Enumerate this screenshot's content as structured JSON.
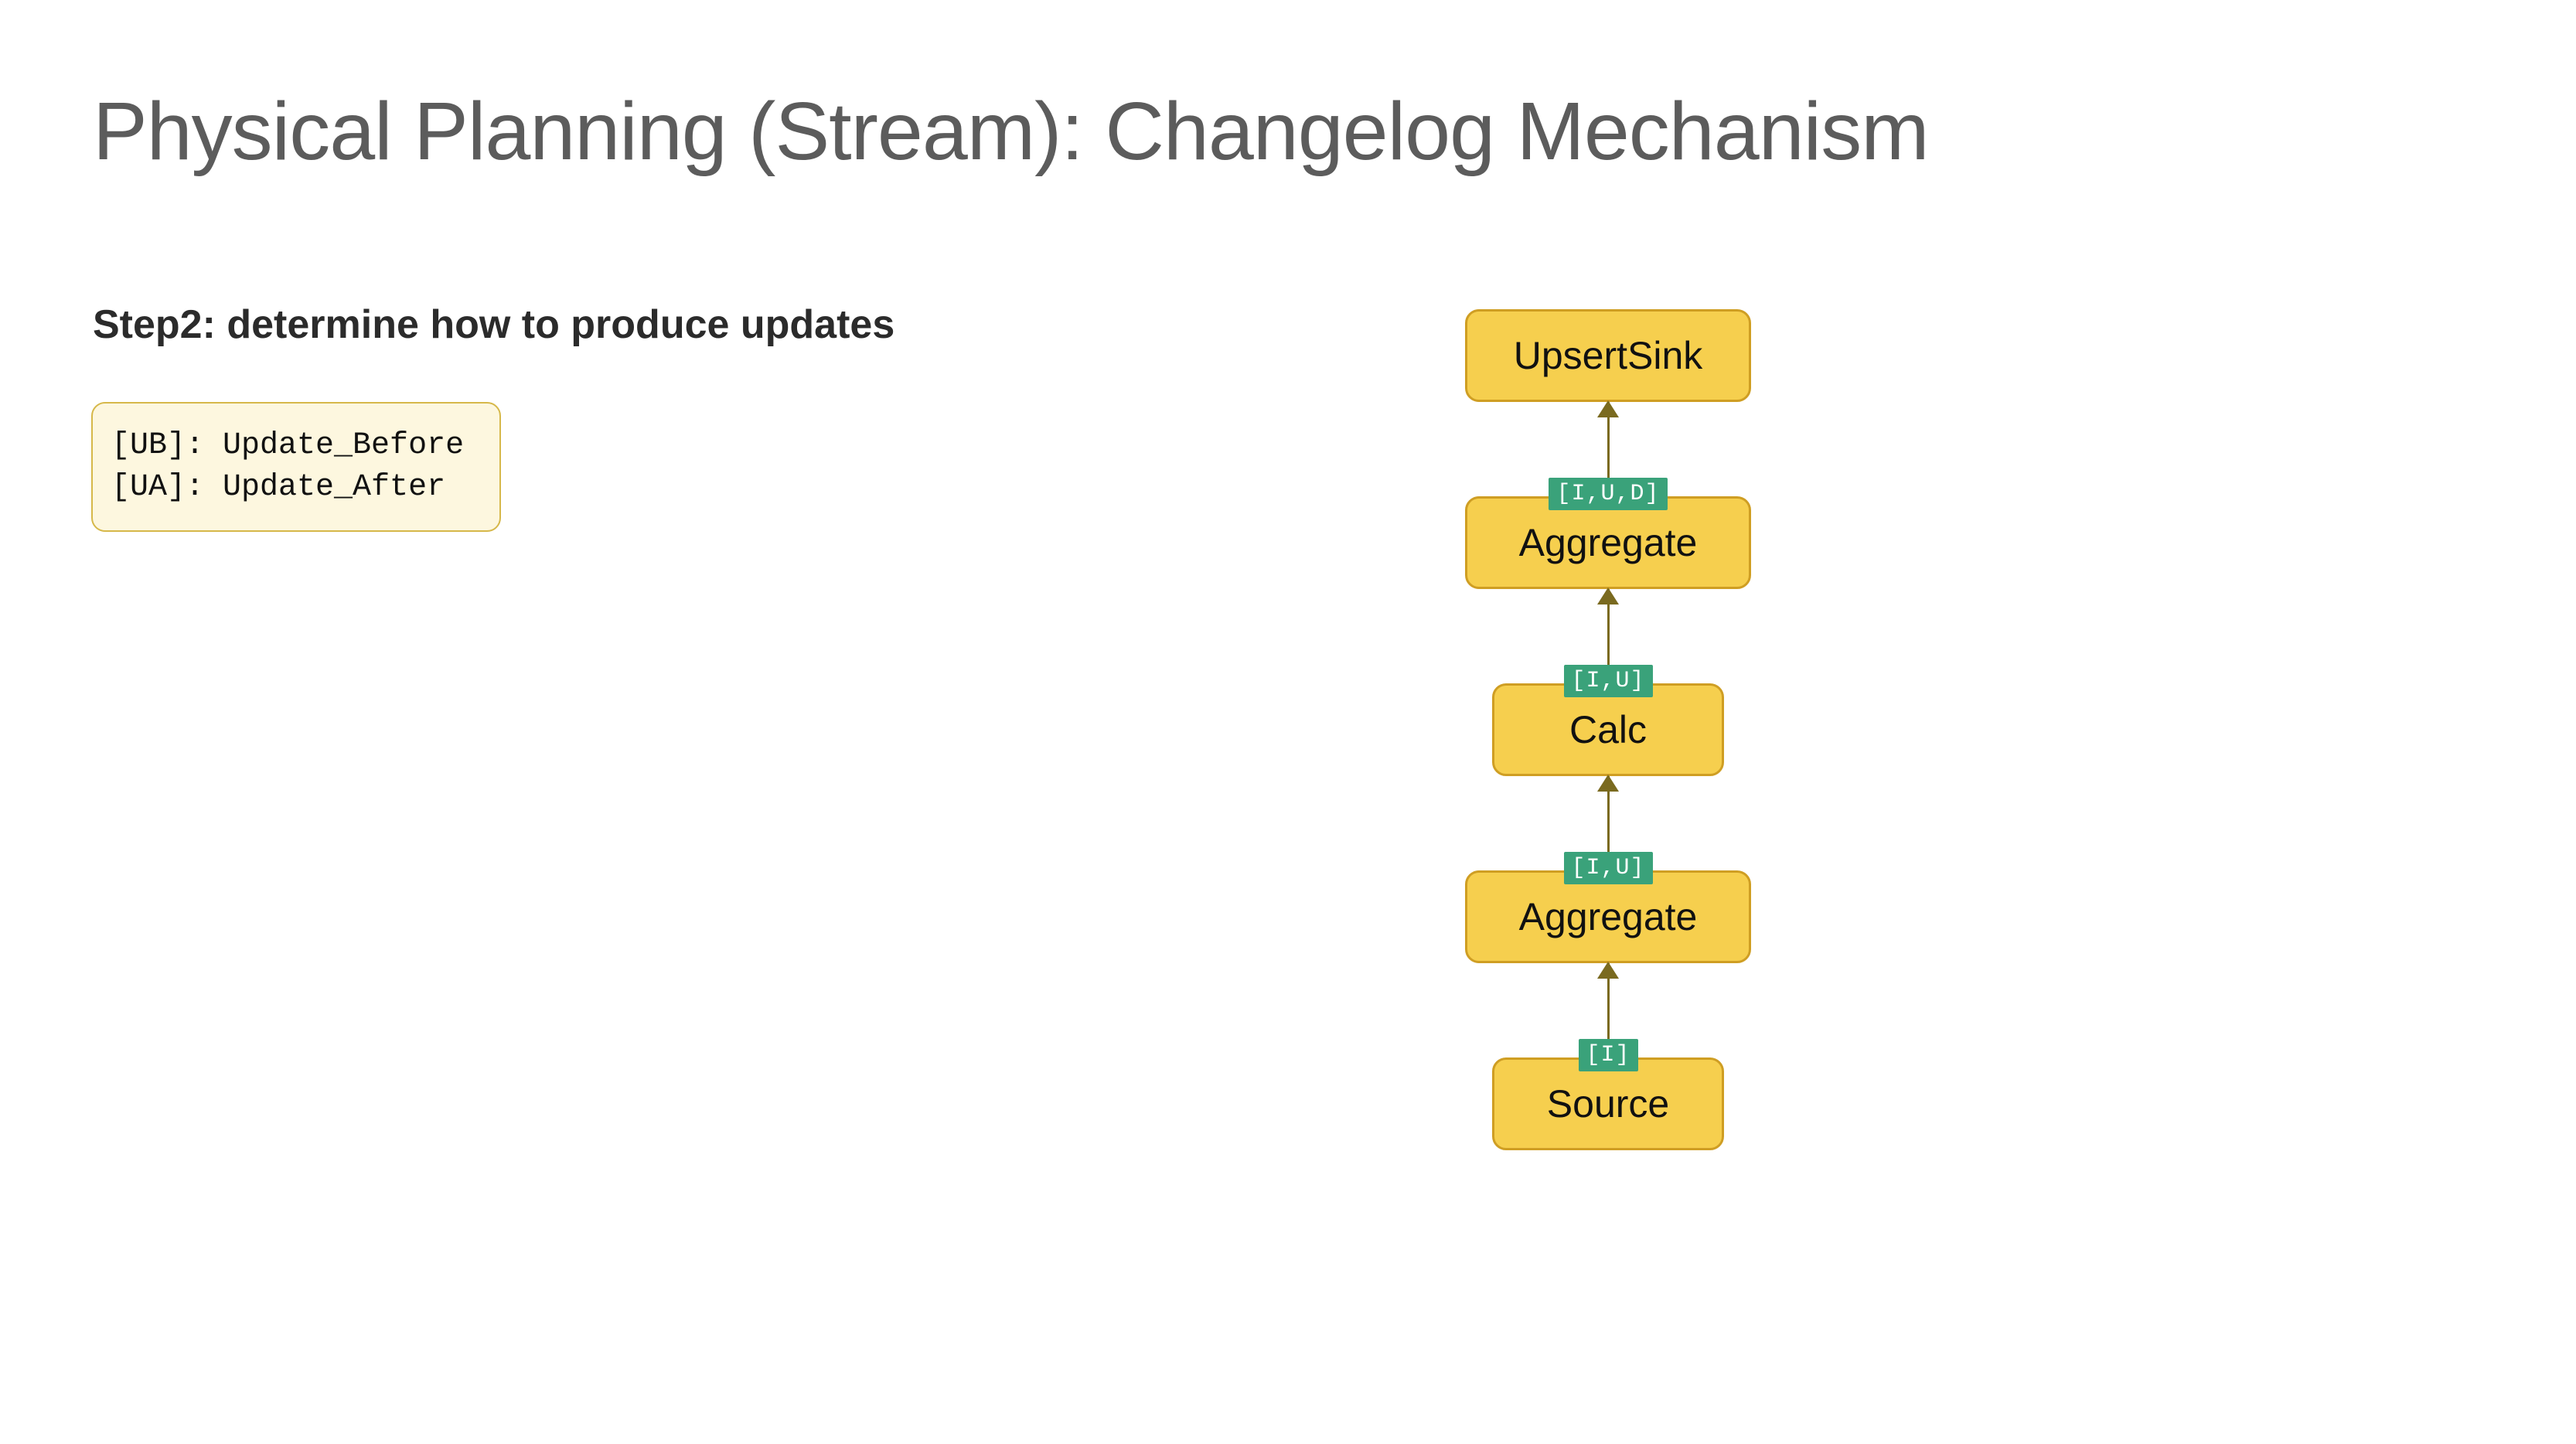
{
  "title": "Physical Planning (Stream): Changelog Mechanism",
  "subtitle": "Step2: determine how to produce updates",
  "legend": {
    "line1": "[UB]: Update_Before",
    "line2": "[UA]: Update_After"
  },
  "nodes": {
    "upsertSink": "UpsertSink",
    "aggregateTop": "Aggregate",
    "calc": "Calc",
    "aggregateBottom": "Aggregate",
    "source": "Source"
  },
  "badges": {
    "b1": "[I,U,D]",
    "b2": "[I,U]",
    "b3": "[I,U]",
    "b4": "[I]"
  },
  "colors": {
    "nodeFill": "#f6cf4e",
    "nodeBorder": "#cf9e23",
    "badgeFill": "#3aa27a",
    "arrow": "#7a6a1f",
    "legendFill": "#fdf7df"
  }
}
